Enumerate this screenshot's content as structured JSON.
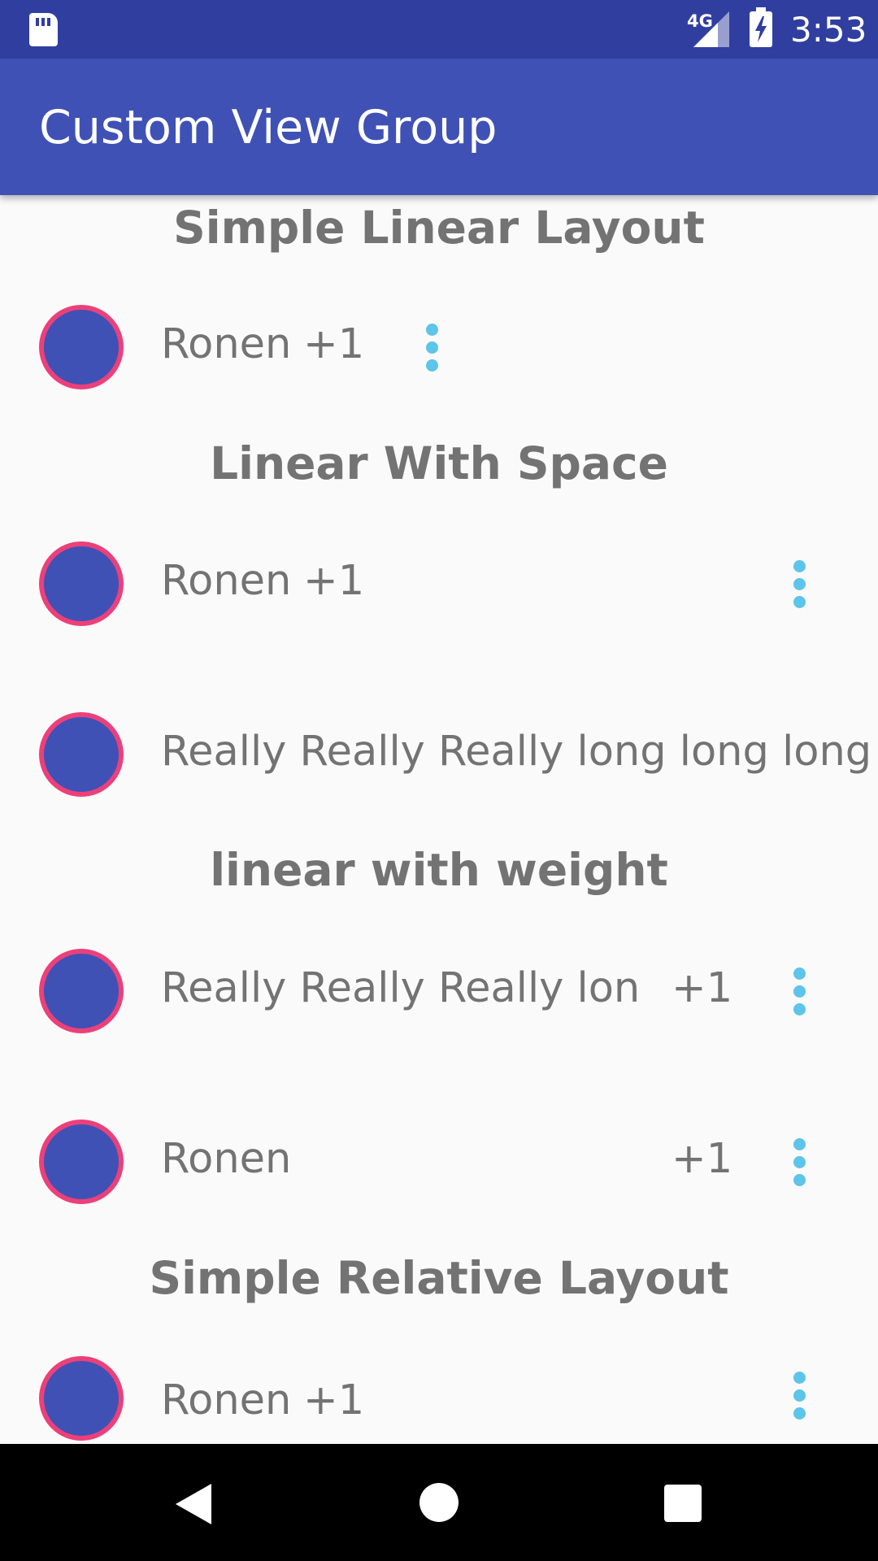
{
  "status_bar": {
    "network": "4G",
    "time": "3:53",
    "icons": [
      "sd-card-icon",
      "signal-icon",
      "battery-charging-icon"
    ]
  },
  "app_bar": {
    "title": "Custom View Group"
  },
  "sections": {
    "simple_linear": {
      "title": "Simple Linear Layout",
      "rows": [
        {
          "name": "Ronen",
          "count": "+1"
        }
      ]
    },
    "linear_space": {
      "title": "Linear With Space",
      "rows": [
        {
          "name": "Ronen",
          "count": "+1"
        },
        {
          "name": "Really Really Really long long long l…"
        }
      ]
    },
    "linear_weight": {
      "title": "linear with weight",
      "rows": [
        {
          "name": "Really Really Really lon…",
          "count": "+1"
        },
        {
          "name": "Ronen",
          "count": "+1"
        }
      ]
    },
    "simple_relative": {
      "title": "Simple Relative Layout",
      "rows": [
        {
          "name": "Ronen",
          "count": "+1"
        }
      ]
    }
  },
  "colors": {
    "status_bar": "#303f9f",
    "app_bar": "#3f51b5",
    "avatar_fill": "#3f51b5",
    "avatar_border": "#ec407a",
    "more_dots": "#5dc4ea",
    "text_gray": "#737373",
    "background": "#fafafa"
  },
  "nav_bar": {
    "icons": [
      "back-icon",
      "home-icon",
      "recents-icon"
    ]
  }
}
